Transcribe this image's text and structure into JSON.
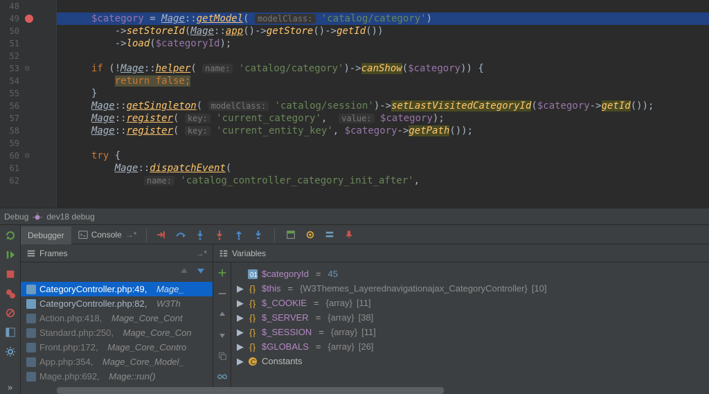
{
  "editor": {
    "lines": [
      {
        "num": 48
      },
      {
        "num": 49,
        "breakpoint": true
      },
      {
        "num": 50
      },
      {
        "num": 51
      },
      {
        "num": 52
      },
      {
        "num": 53,
        "fold": true
      },
      {
        "num": 54
      },
      {
        "num": 55
      },
      {
        "num": 56
      },
      {
        "num": 57
      },
      {
        "num": 58
      },
      {
        "num": 59
      },
      {
        "num": 60,
        "fold": true
      },
      {
        "num": 61
      },
      {
        "num": 62
      }
    ],
    "code": {
      "l49_var": "$category",
      "l49_cls": "Mage",
      "l49_fn": "getModel",
      "l49_hint": "modelClass:",
      "l49_str": "'catalog/category'",
      "l50_fn1": "setStoreId",
      "l50_cls": "Mage",
      "l50_fn2": "app",
      "l50_fn3": "getStore",
      "l50_fn4": "getId",
      "l51_fn": "load",
      "l51_var": "$categoryId",
      "l53_kw": "if",
      "l53_cls": "Mage",
      "l53_fn1": "helper",
      "l53_hint": "name:",
      "l53_str": "'catalog/category'",
      "l53_fn2": "canShow",
      "l53_var": "$category",
      "l54_kw": "return false;",
      "l56_cls": "Mage",
      "l56_fn1": "getSingleton",
      "l56_hint": "modelClass:",
      "l56_str": "'catalog/session'",
      "l56_fn2": "setLastVisitedCategoryId",
      "l56_var": "$category",
      "l56_fn3": "getId",
      "l57_cls": "Mage",
      "l57_fn": "register",
      "l57_hint1": "key:",
      "l57_str": "'current_category'",
      "l57_hint2": "value:",
      "l57_var": "$category",
      "l58_cls": "Mage",
      "l58_fn": "register",
      "l58_hint": "key:",
      "l58_str": "'current_entity_key'",
      "l58_var": "$category",
      "l58_fn2": "getPath",
      "l60_kw": "try",
      "l61_cls": "Mage",
      "l61_fn": "dispatchEvent",
      "l62_hint": "name:",
      "l62_str": "'catalog_controller_category_init_after'"
    }
  },
  "debug": {
    "title_prefix": "Debug",
    "config_name": "dev18 debug",
    "tabs": {
      "debugger": "Debugger",
      "console": "Console"
    },
    "frames": {
      "title": "Frames",
      "items": [
        {
          "file": "CategoryController.php:49,",
          "ctx": "Mage_",
          "selected": true
        },
        {
          "file": "CategoryController.php:82,",
          "ctx": "W3Th"
        },
        {
          "file": "Action.php:418,",
          "ctx": "Mage_Core_Cont",
          "dim": true
        },
        {
          "file": "Standard.php:250,",
          "ctx": "Mage_Core_Con",
          "dim": true
        },
        {
          "file": "Front.php:172,",
          "ctx": "Mage_Core_Contro",
          "dim": true
        },
        {
          "file": "App.php:354,",
          "ctx": "Mage_Core_Model_",
          "dim": true
        },
        {
          "file": "Mage.php:692,",
          "ctx": "Mage::run()",
          "dim": true
        }
      ]
    },
    "variables": {
      "title": "Variables",
      "items": [
        {
          "icon": "const",
          "name": "$categoryId",
          "eq": "=",
          "val": "45",
          "expandable": false,
          "nameClass": "pr"
        },
        {
          "icon": "brace",
          "name": "$this",
          "eq": "=",
          "type": "{W3Themes_Layerednavigationajax_CategoryController}",
          "suffix": " [10]",
          "expandable": true,
          "nameClass": "pr"
        },
        {
          "icon": "brace",
          "name": "$_COOKIE",
          "eq": "=",
          "type": "{array}",
          "suffix": " [11]",
          "expandable": true,
          "nameClass": "pr"
        },
        {
          "icon": "brace",
          "name": "$_SERVER",
          "eq": "=",
          "type": "{array}",
          "suffix": " [38]",
          "expandable": true,
          "nameClass": "pr"
        },
        {
          "icon": "brace",
          "name": "$_SESSION",
          "eq": "=",
          "type": "{array}",
          "suffix": " [11]",
          "expandable": true,
          "nameClass": "pr"
        },
        {
          "icon": "brace",
          "name": "$GLOBALS",
          "eq": "=",
          "type": "{array}",
          "suffix": " [26]",
          "expandable": true,
          "nameClass": "pr"
        },
        {
          "icon": "c",
          "name": "Constants",
          "expandable": true,
          "nameClass": ""
        }
      ]
    }
  }
}
